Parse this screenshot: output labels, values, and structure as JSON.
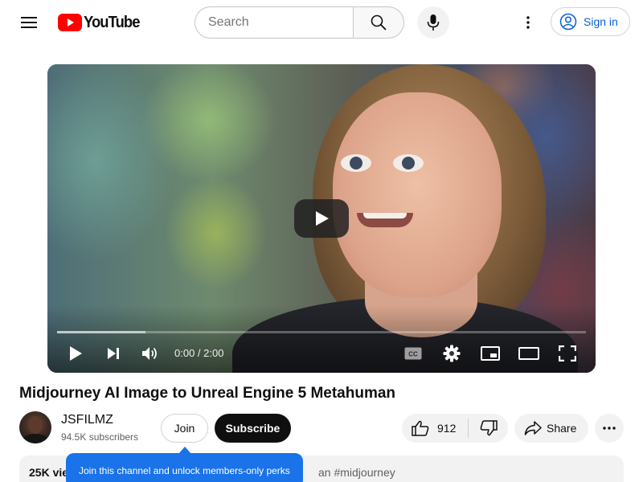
{
  "header": {
    "logo_text": "YouTube",
    "search_placeholder": "Search",
    "signin_label": "Sign in"
  },
  "player": {
    "time": "0:00 / 2:00",
    "progress_loaded_fraction": 0.167,
    "icons": [
      "play-icon",
      "next-icon",
      "volume-icon",
      "captions-icon",
      "settings-icon",
      "miniplayer-icon",
      "theater-icon",
      "fullscreen-icon"
    ]
  },
  "video": {
    "title": "Midjourney AI Image to Unreal Engine 5 Metahuman"
  },
  "channel": {
    "name": "JSFILMZ",
    "subscribers": "94.5K subscribers",
    "join_label": "Join",
    "subscribe_label": "Subscribe"
  },
  "actions": {
    "likes": "912",
    "share_label": "Share"
  },
  "description": {
    "views": "25K vie",
    "tags": "an #midjourney"
  },
  "tooltip": {
    "text": "Join this channel and unlock members-only perks"
  },
  "colors": {
    "brand_red": "#ff0000",
    "link_blue": "#065fd4",
    "tooltip_blue": "#1a73e8"
  }
}
